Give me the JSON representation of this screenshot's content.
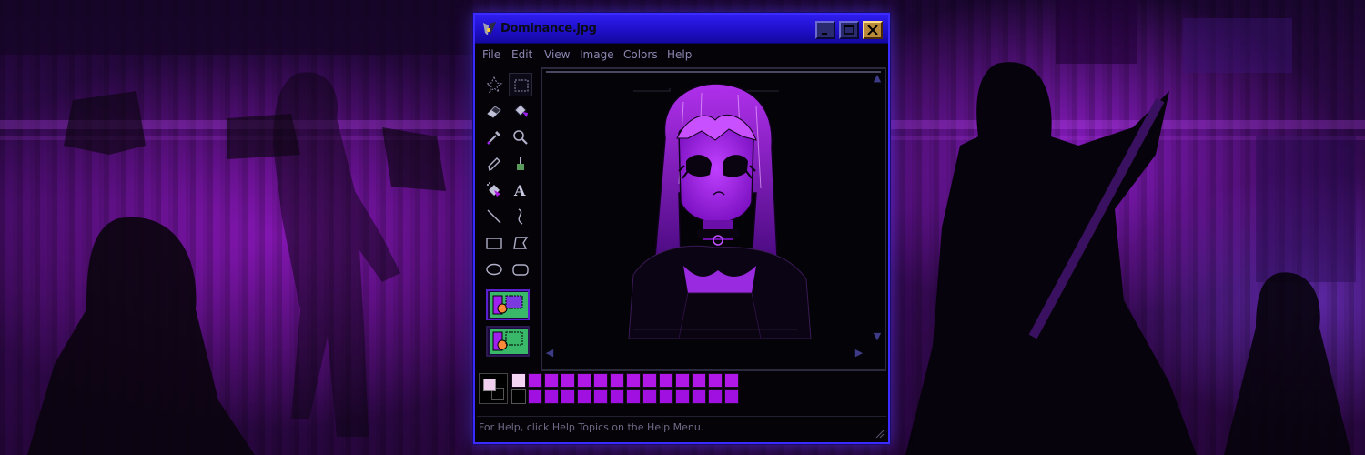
{
  "window": {
    "title": "Dominance.jpg",
    "title_icon": "paint-app-icon",
    "controls": [
      "minimize-icon",
      "maximize-icon",
      "close-icon"
    ]
  },
  "menu": [
    {
      "label": "File"
    },
    {
      "label": "Edit"
    },
    {
      "label": "View"
    },
    {
      "label": "Image"
    },
    {
      "label": "Colors"
    },
    {
      "label": "Help"
    }
  ],
  "tools": [
    {
      "name": "free-form-select-icon",
      "selected": false
    },
    {
      "name": "rect-select-icon",
      "selected": true
    },
    {
      "name": "eraser-icon",
      "selected": false
    },
    {
      "name": "fill-bucket-icon",
      "selected": false
    },
    {
      "name": "color-picker-icon",
      "selected": false
    },
    {
      "name": "magnifier-icon",
      "selected": false
    },
    {
      "name": "pencil-icon",
      "selected": false
    },
    {
      "name": "brush-icon",
      "selected": false
    },
    {
      "name": "airbrush-icon",
      "selected": false
    },
    {
      "name": "text-icon",
      "selected": false
    },
    {
      "name": "line-icon",
      "selected": false
    },
    {
      "name": "curve-icon",
      "selected": false
    },
    {
      "name": "rectangle-icon",
      "selected": false
    },
    {
      "name": "polygon-icon",
      "selected": false
    },
    {
      "name": "ellipse-icon",
      "selected": false
    },
    {
      "name": "rounded-rect-icon",
      "selected": false
    }
  ],
  "text_tool_glyph": "A",
  "colors": {
    "titlebar": "#2f1df0",
    "window_border": "#3b2bff",
    "accent_purple": "#a020f0",
    "foreground": "#f0cfee",
    "background": "#000000"
  },
  "palette": {
    "top": [
      "#f4d6f4",
      "#b018e8",
      "#b018e8",
      "#b018e8",
      "#b018e8",
      "#b018e8",
      "#b018e8",
      "#b018e8",
      "#b018e8",
      "#b018e8",
      "#b018e8",
      "#b018e8",
      "#b018e8",
      "#b018e8"
    ],
    "bottom": [
      "#000000",
      "#a010e0",
      "#a010e0",
      "#a010e0",
      "#a010e0",
      "#a010e0",
      "#a010e0",
      "#a010e0",
      "#a010e0",
      "#a010e0",
      "#a010e0",
      "#a010e0",
      "#a010e0",
      "#a010e0"
    ]
  },
  "status": {
    "help_text": "For Help, click Help Topics on the Help Menu."
  }
}
